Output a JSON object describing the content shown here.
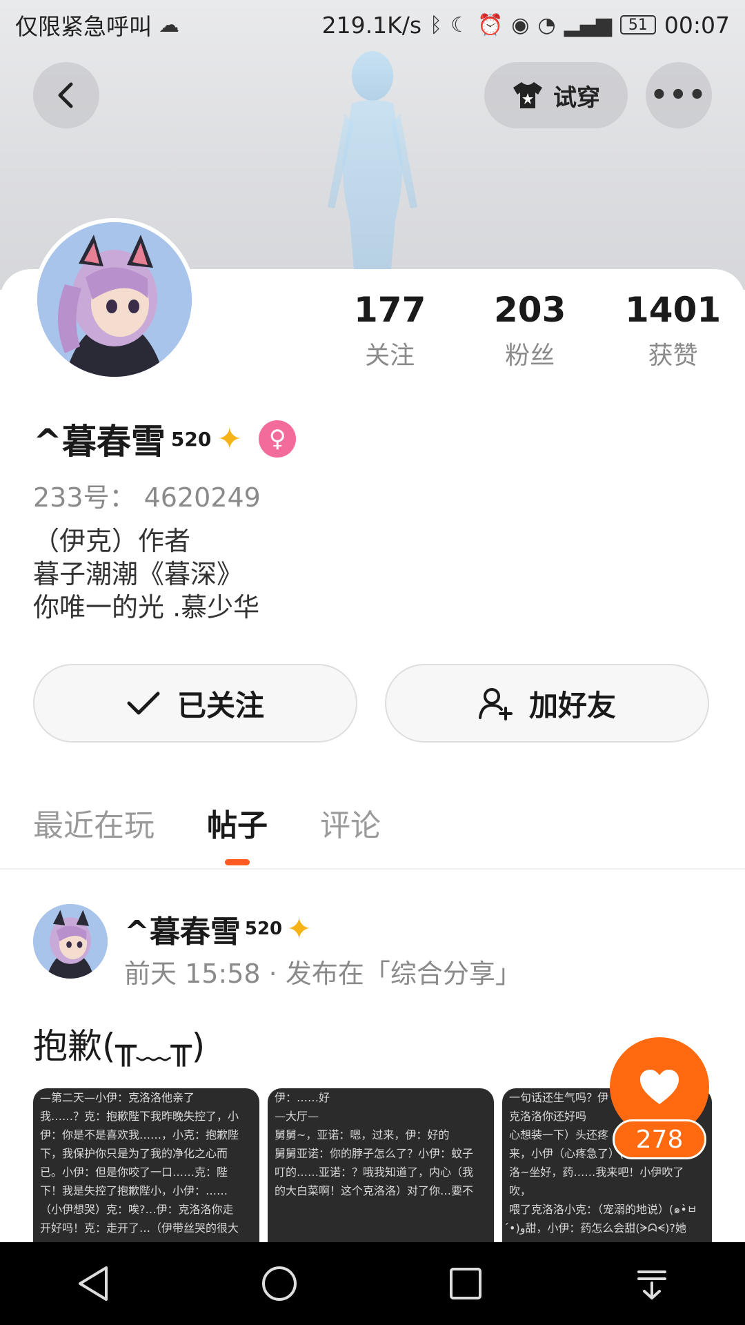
{
  "status_bar": {
    "carrier": "仅限紧急呼叫",
    "speed": "219.1K/s",
    "battery": "51",
    "time": "00:07"
  },
  "header": {
    "try_on_label": "试穿"
  },
  "stats": [
    {
      "value": "177",
      "label": "关注"
    },
    {
      "value": "203",
      "label": "粉丝"
    },
    {
      "value": "1401",
      "label": "获赞"
    }
  ],
  "profile": {
    "name": "^暮春雪",
    "name_suffix": "520",
    "uid": "233号： 4620249",
    "bio": [
      "（伊克）作者",
      "暮子潮潮《暮深》",
      "你唯一的光 .慕少华"
    ]
  },
  "actions": {
    "follow_label": "已关注",
    "add_friend_label": "加好友"
  },
  "tabs": [
    "最近在玩",
    "帖子",
    "评论"
  ],
  "active_tab": "帖子",
  "post": {
    "author": "^暮春雪",
    "author_suffix": "520",
    "meta": "前天 15:58 · 发布在「综合分享」",
    "title": "抱歉(╥﹏╥)",
    "likes": "278",
    "thumbs": [
      [
        "—第二天—小伊：克洛洛他亲了",
        "我……？克：抱歉陛下我昨晚失控了，小",
        "伊：你是不是喜欢我……，小克：抱歉陛",
        "下，我保护你只是为了我的净化之心而",
        "已。小伊：但是你咬了一口……克：陛",
        "下！我是失控了抱歉陛小，小伊：……",
        "（小伊想哭）克：唉?…伊：克洛洛你走",
        "开好吗！克：走开了…（伊带丝哭的很大"
      ],
      [
        "伊：……好",
        "",
        "—大厅—",
        "",
        "舅舅~，亚诺：嗯，过来，伊：好的",
        "舅舅亚诺：你的脖子怎么了？小伊：蚊子",
        "叮的……亚诺：？哦我知道了，内心（我",
        "的大白菜啊！这个克洛洛）对了你…要不"
      ],
      [
        "一句话还生气吗？伊",
        "",
        "克洛洛你还好吗",
        "心想装一下）头还疼",
        "来，小伊（心疼急了）(▬ˇ﹏ˇ▬)克洛",
        "洛~坐好，药……我来吧！小伊吹了吹，",
        "喂了克洛洛小克：（宠溺的地说）(๑•̀ㅂ",
        "•́)و甜，小伊：药怎么会甜(ᗒᗣᗕ)?她"
      ]
    ]
  },
  "colors": {
    "accent": "#ff6a10",
    "gender_badge": "#f36b9a",
    "tab_indicator": "#ff5a1f"
  }
}
